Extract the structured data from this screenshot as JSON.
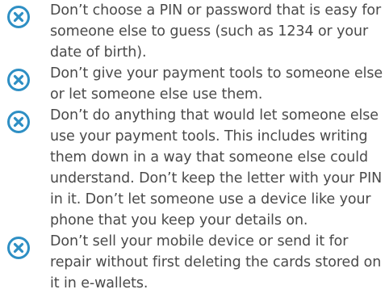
{
  "accent_color": "#2e8fc4",
  "text_color": "#4a4a4a",
  "items": [
    {
      "icon": "x-circle-icon",
      "text": "Don’t choose a PIN or password that is easy for someone else to guess (such as 1234 or your date of birth)."
    },
    {
      "icon": "x-circle-icon",
      "text": "Don’t give your payment tools to someone else or let someone else use them."
    },
    {
      "icon": "x-circle-icon",
      "text": "Don’t do anything that would let someone else use your payment tools. This includes writing them down in a way that someone else could understand. Don’t keep the letter with your PIN in it. Don’t let someone use a device like your phone that you keep your details on."
    },
    {
      "icon": "x-circle-icon",
      "text": "Don’t sell your mobile device or send it for repair without first deleting the cards stored on it in e-wallets."
    }
  ]
}
